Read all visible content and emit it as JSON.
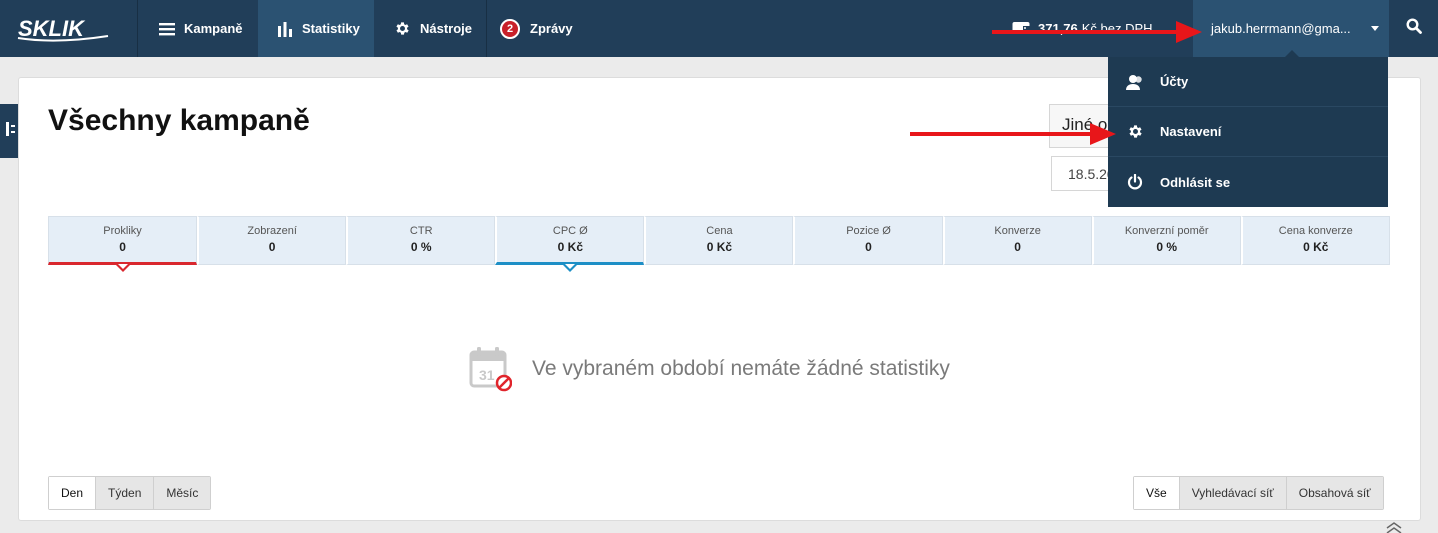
{
  "brand": {
    "logo_text": "SKLIK"
  },
  "nav": {
    "items": [
      {
        "label": "Kampaně",
        "icon": "menu-icon"
      },
      {
        "label": "Statistiky",
        "icon": "bar-chart-icon"
      },
      {
        "label": "Nástroje",
        "icon": "gear-icon"
      },
      {
        "label": "Zprávy",
        "icon": "badge",
        "badge": "2"
      }
    ]
  },
  "credit": {
    "amount": "371,76",
    "unit": "Kč bez DPH"
  },
  "user": {
    "email": "jakub.herrmann@gma..."
  },
  "user_menu": {
    "items": [
      {
        "label": "Účty",
        "icon": "users-icon"
      },
      {
        "label": "Nastavení",
        "icon": "gear-icon"
      },
      {
        "label": "Odhlásit se",
        "icon": "power-icon"
      }
    ]
  },
  "page": {
    "title": "Všechny kampaně",
    "date_button": "Jiné o",
    "date_value": "18.5.20"
  },
  "metrics": [
    {
      "label": "Prokliky",
      "value": "0"
    },
    {
      "label": "Zobrazení",
      "value": "0"
    },
    {
      "label": "CTR",
      "value": "0 %"
    },
    {
      "label": "CPC Ø",
      "value": "0 Kč"
    },
    {
      "label": "Cena",
      "value": "0 Kč"
    },
    {
      "label": "Pozice Ø",
      "value": "0"
    },
    {
      "label": "Konverze",
      "value": "0"
    },
    {
      "label": "Konverzní poměr",
      "value": "0 %"
    },
    {
      "label": "Cena konverze",
      "value": "0 Kč"
    }
  ],
  "empty_state": {
    "text": "Ve vybraném období nemáte žádné statistiky",
    "calendar_day": "31"
  },
  "period": {
    "options": [
      "Den",
      "Týden",
      "Měsíc"
    ],
    "selected": "Den"
  },
  "network": {
    "options": [
      "Vše",
      "Vyhledávací síť",
      "Obsahová síť"
    ],
    "selected": "Vše"
  },
  "colors": {
    "topbar": "#213e59",
    "active": "#2b5272",
    "red": "#d9272e",
    "blue": "#1d8fc6",
    "annotation": "#e8161a"
  }
}
